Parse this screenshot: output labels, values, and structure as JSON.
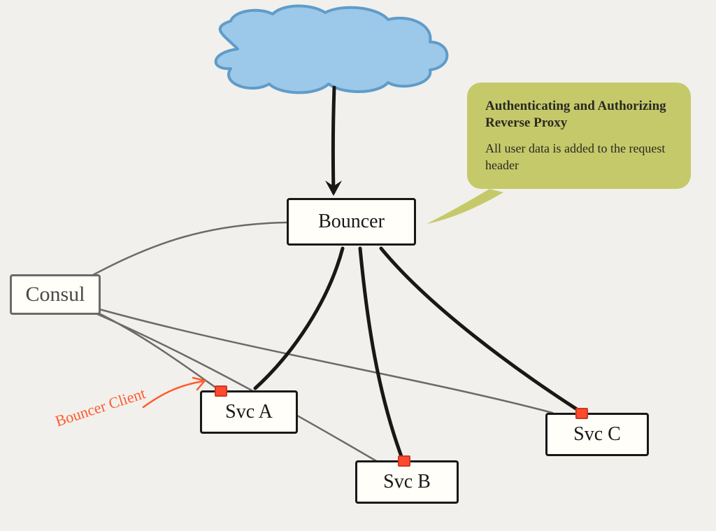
{
  "nodes": {
    "cloud": {
      "label": ""
    },
    "bouncer": {
      "label": "Bouncer"
    },
    "consul": {
      "label": "Consul"
    },
    "svcA": {
      "label": "Svc A"
    },
    "svcB": {
      "label": "Svc B"
    },
    "svcC": {
      "label": "Svc C"
    }
  },
  "callout": {
    "title": "Authenticating and Authorizing Reverse Proxy",
    "body": "All user data is added to the request header"
  },
  "annotation": {
    "bouncerClient": "Bouncer Client"
  },
  "edges": [
    {
      "from": "cloud",
      "to": "bouncer",
      "style": "solid-arrow"
    },
    {
      "from": "bouncer",
      "to": "svcA",
      "style": "solid"
    },
    {
      "from": "bouncer",
      "to": "svcB",
      "style": "solid"
    },
    {
      "from": "bouncer",
      "to": "svcC",
      "style": "solid"
    },
    {
      "from": "consul",
      "to": "bouncer",
      "style": "thin"
    },
    {
      "from": "consul",
      "to": "svcA",
      "style": "thin"
    },
    {
      "from": "consul",
      "to": "svcB",
      "style": "thin"
    },
    {
      "from": "consul",
      "to": "svcC",
      "style": "thin"
    }
  ],
  "colors": {
    "cloudFill": "#9cc8e9",
    "cloudStroke": "#5f9cc9",
    "calloutFill": "#c5c96a",
    "accentRed": "#ff4a2e",
    "lineDark": "#1a1816",
    "lineGray": "#6c6a68"
  }
}
